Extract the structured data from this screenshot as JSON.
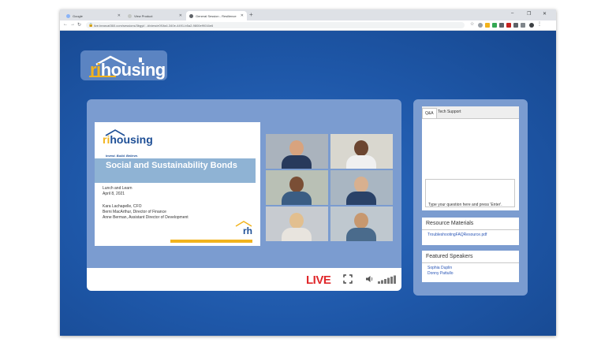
{
  "browser": {
    "tabs": [
      {
        "label": "Google",
        "active": false
      },
      {
        "label": "View Product",
        "active": false
      },
      {
        "label": "General Session - Resilience",
        "active": true
      }
    ],
    "url": "live.bearcat360.com/sessions/3bgyt/...#/view/e0f1fa4-340e-4491-b5a2-9800ef9016e6"
  },
  "brand": {
    "ri": "ri",
    "housing": "housing",
    "tagline": "Invest. Build. Believe.",
    "mark": "rh",
    "colors": {
      "blue": "#1e4f96",
      "gold": "#f2b31c",
      "live_red": "#e0282b"
    }
  },
  "slide": {
    "title": "Social and Sustainability Bonds",
    "event": "Lunch and Learn",
    "date": "April 8, 2021",
    "presenters": [
      "Kara Lachapelle, CFO",
      "Berni MacArthur, Director of Finance",
      "Anne Berman, Assistant Director of Development"
    ]
  },
  "player": {
    "live_label": "LIVE"
  },
  "qa": {
    "tabs": [
      "Q&A",
      "Tech Support"
    ],
    "placeholder": "Type your question here and press 'Enter'."
  },
  "resources": {
    "title": "Resource Materials",
    "items": [
      "TroubleshootingFAQResource.pdf"
    ]
  },
  "speakers": {
    "title": "Featured Speakers",
    "items": [
      "Sophia Duplin",
      "Donny Pattullo"
    ]
  }
}
